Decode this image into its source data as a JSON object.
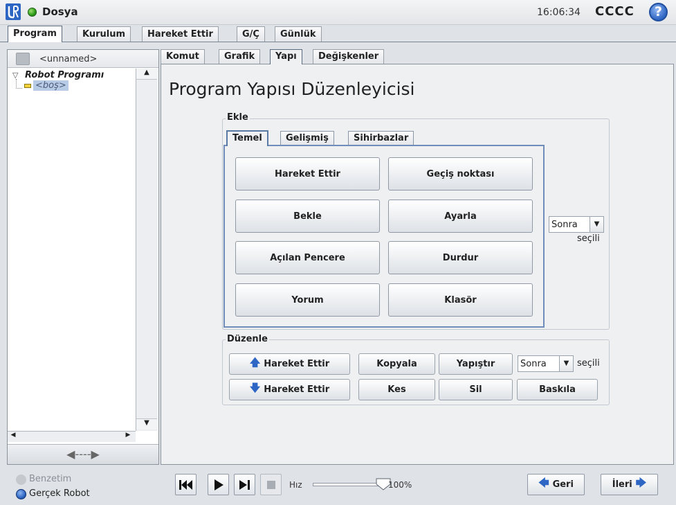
{
  "titlebar": {
    "file_menu": "Dosya",
    "clock": "16:06:34",
    "robot_name": "CCCC",
    "help": "?"
  },
  "main_tabs": [
    "Program",
    "Kurulum",
    "Hareket Ettir",
    "G/Ç",
    "Günlük"
  ],
  "program": {
    "name": "<unnamed>",
    "tree": {
      "root": "Robot Programı",
      "child": "<boş>"
    },
    "resize_glyph": "◀----▶"
  },
  "sub_tabs": [
    "Komut",
    "Grafik",
    "Yapı",
    "Değişkenler"
  ],
  "page_title": "Program Yapısı Düzenleyicisi",
  "insert": {
    "label": "Ekle",
    "tabs": [
      "Temel",
      "Gelişmiş",
      "Sihirbazlar"
    ],
    "buttons": [
      "Hareket Ettir",
      "Geçiş noktası",
      "Bekle",
      "Ayarla",
      "Açılan Pencere",
      "Durdur",
      "Yorum",
      "Klasör"
    ],
    "position_select": "Sonra",
    "position_suffix": "seçili"
  },
  "edit": {
    "label": "Düzenle",
    "move_up": "Hareket Ettir",
    "move_down": "Hareket Ettir",
    "copy": "Kopyala",
    "paste": "Yapıştır",
    "cut": "Kes",
    "delete": "Sil",
    "suppress": "Baskıla",
    "position_select": "Sonra",
    "position_suffix": "seçili"
  },
  "bottom": {
    "simulation": "Benzetim",
    "real_robot": "Gerçek Robot",
    "speed_label": "Hız",
    "speed_value": "100%",
    "speed_fraction": 1.0,
    "back": "Geri",
    "next": "İleri"
  },
  "colors": {
    "accent_blue": "#2e66c4",
    "active_tab_border": "#6f8db8",
    "status_green": "#2a9a1a"
  }
}
